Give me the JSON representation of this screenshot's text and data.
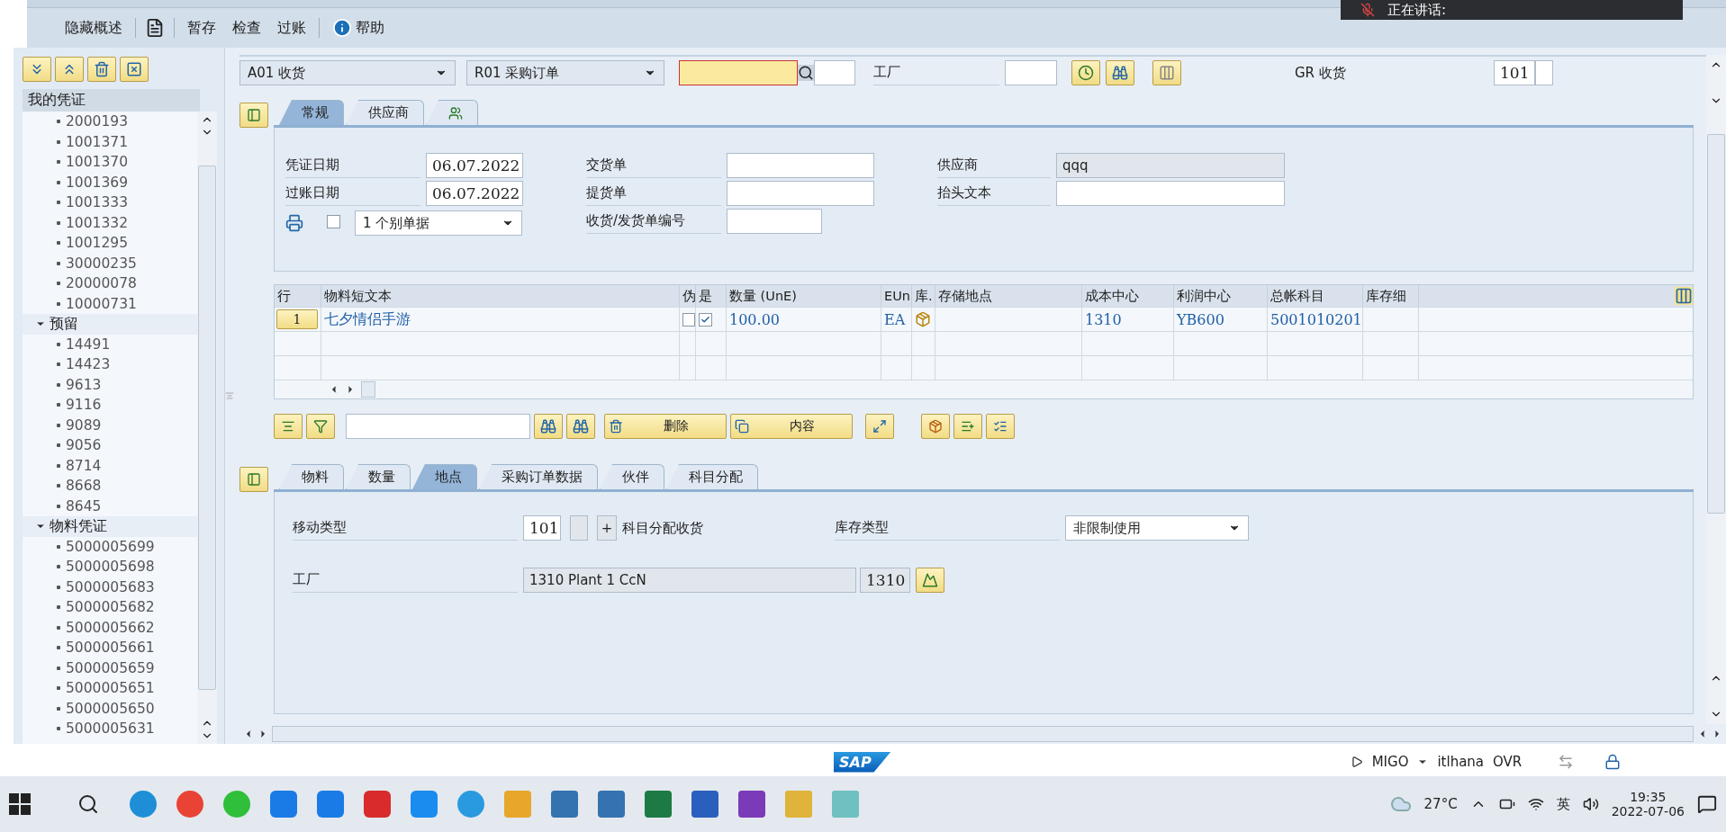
{
  "toolbar": {
    "buttons": [
      {
        "kind": "text",
        "label": "隐藏概述"
      },
      {
        "kind": "icon"
      },
      {
        "kind": "text",
        "label": "暂存"
      },
      {
        "kind": "text",
        "label": "检查"
      },
      {
        "kind": "text",
        "label": "过账"
      },
      {
        "kind": "help",
        "label": "帮助"
      }
    ]
  },
  "notification": {
    "text": "正在讲话:"
  },
  "sidebar": {
    "title": "我的凭证",
    "tree": [
      {
        "children": [
          {
            "label": "2000193"
          },
          {
            "label": "1001371"
          },
          {
            "label": "1001370"
          },
          {
            "label": "1001369"
          },
          {
            "label": "1001333"
          },
          {
            "label": "1001332"
          },
          {
            "label": "1001295"
          },
          {
            "label": "30000235"
          },
          {
            "label": "20000078"
          },
          {
            "label": "10000731"
          }
        ]
      },
      {
        "label": "预留",
        "expanded": true,
        "children": [
          {
            "label": "14491"
          },
          {
            "label": "14423"
          },
          {
            "label": "9613"
          },
          {
            "label": "9116"
          },
          {
            "label": "9089"
          },
          {
            "label": "9056"
          },
          {
            "label": "8714"
          },
          {
            "label": "8668"
          },
          {
            "label": "8645"
          }
        ]
      },
      {
        "label": "物料凭证",
        "expanded": true,
        "children": [
          {
            "label": "5000005699"
          },
          {
            "label": "5000005698"
          },
          {
            "label": "5000005683"
          },
          {
            "label": "5000005682"
          },
          {
            "label": "5000005662"
          },
          {
            "label": "5000005661"
          },
          {
            "label": "5000005659"
          },
          {
            "label": "5000005651"
          },
          {
            "label": "5000005650"
          },
          {
            "label": "5000005631"
          }
        ]
      }
    ]
  },
  "header": {
    "action": "A01 收货",
    "reference": "R01 采购订单",
    "plant_label": "工厂",
    "gr_label": "GR 收货",
    "movement_type": "101"
  },
  "top_tabs": [
    {
      "kind": "text",
      "label": "常规",
      "selected": true
    },
    {
      "kind": "text",
      "label": "供应商",
      "selected": false
    },
    {
      "kind": "icon",
      "selected": false
    }
  ],
  "general": {
    "left": [
      {
        "label": "凭证日期",
        "value": "06.07.2022"
      },
      {
        "label": "过账日期",
        "value": "06.07.2022"
      }
    ],
    "print_checked": false,
    "print_option": "1 个别单据",
    "middle": [
      {
        "label": "交货单"
      },
      {
        "label": "提货单"
      },
      {
        "label": "收货/发货单编号"
      }
    ],
    "right": [
      {
        "label": "供应商",
        "value": "qqq",
        "disabled": true
      },
      {
        "label": "抬头文本",
        "disabled": false
      }
    ]
  },
  "items_table": {
    "columns": [
      "行",
      "物料短文本",
      "伪",
      "是",
      "数量 (UnE)",
      "EUn",
      "库.",
      "存储地点",
      "成本中心",
      "利润中心",
      "总帐科目",
      "库存细"
    ],
    "rows": [
      {
        "cells": [
          {
            "kind": "button",
            "text": "1"
          },
          {
            "kind": "text",
            "text": "七夕情侣手游"
          },
          {
            "kind": "checkbox",
            "checked": false
          },
          {
            "kind": "checkbox",
            "checked": true
          },
          {
            "kind": "text",
            "text": "100.00"
          },
          {
            "kind": "text",
            "text": "EA"
          },
          {
            "kind": "icon"
          },
          {
            "kind": "empty"
          },
          {
            "kind": "text",
            "text": "1310"
          },
          {
            "kind": "text",
            "text": "YB600"
          },
          {
            "kind": "text",
            "text": "5001010201"
          },
          {
            "kind": "empty"
          }
        ]
      }
    ]
  },
  "item_toolbar": {
    "delete": "删除",
    "contents": "内容"
  },
  "detail_tabs": [
    {
      "label": "物料",
      "selected": false
    },
    {
      "label": "数量",
      "selected": false
    },
    {
      "label": "地点",
      "selected": true
    },
    {
      "label": "采购订单数据",
      "selected": false
    },
    {
      "label": "伙伴",
      "selected": false
    },
    {
      "label": "科目分配",
      "selected": false
    }
  ],
  "detail": {
    "movement_label": "移动类型",
    "movement_type": "101",
    "plus": "+",
    "account_gr": "科目分配收货",
    "stock_type_label": "库存类型",
    "stock_type": "非限制使用",
    "plant_label": "工厂",
    "plant_name": "1310 Plant 1 CcN",
    "plant": "1310"
  },
  "status_bar": {
    "logo": "SAP",
    "transaction": "MIGO",
    "server": "itlhana",
    "mode": "OVR"
  },
  "taskbar": {
    "temperature": "27°C",
    "ime": "英",
    "time": "19:35",
    "date": "2022-07-06"
  }
}
